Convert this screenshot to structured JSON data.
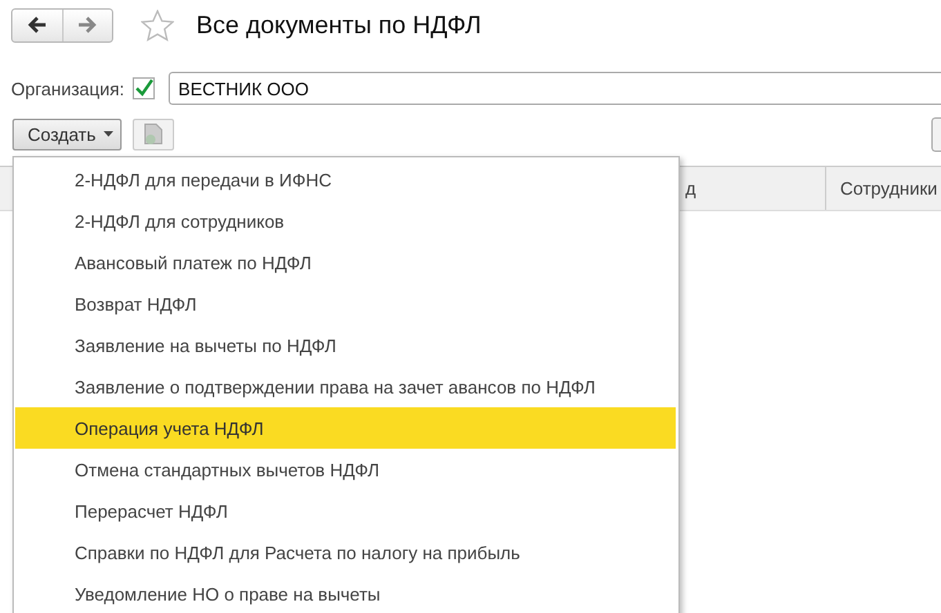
{
  "window": {
    "title": "Все документы по НДФЛ"
  },
  "filter": {
    "label": "Организация:",
    "checked": true,
    "value": "ВЕСТНИК ООО"
  },
  "toolbar": {
    "create_button": "Создать"
  },
  "table": {
    "columns": [
      "д",
      "Сотрудники"
    ]
  },
  "menu": {
    "items": [
      {
        "label": "2-НДФЛ для передачи в ИФНС",
        "selected": false
      },
      {
        "label": "2-НДФЛ для сотрудников",
        "selected": false
      },
      {
        "label": "Авансовый платеж по НДФЛ",
        "selected": false
      },
      {
        "label": "Возврат НДФЛ",
        "selected": false
      },
      {
        "label": "Заявление на вычеты по НДФЛ",
        "selected": false
      },
      {
        "label": "Заявление о подтверждении права на зачет авансов по НДФЛ",
        "selected": false
      },
      {
        "label": "Операция учета НДФЛ",
        "selected": true
      },
      {
        "label": "Отмена стандартных вычетов НДФЛ",
        "selected": false
      },
      {
        "label": "Перерасчет НДФЛ",
        "selected": false
      },
      {
        "label": "Справки по НДФЛ для Расчета по налогу на прибыль",
        "selected": false
      },
      {
        "label": "Уведомление НО о праве на вычеты",
        "selected": false
      }
    ]
  }
}
